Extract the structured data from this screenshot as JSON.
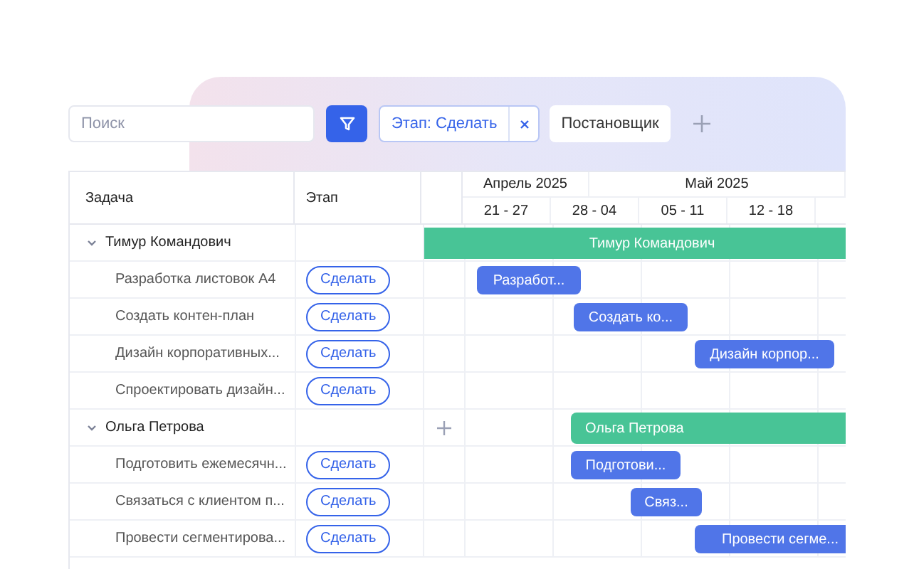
{
  "toolbar": {
    "search": {
      "placeholder": "Поиск"
    },
    "filter_chip": {
      "label": "Этап: Сделать"
    },
    "assignee_button": {
      "label": "Постановщик"
    }
  },
  "table": {
    "columns": [
      "Задача",
      "Этап"
    ],
    "months": [
      "Апрель 2025",
      "Май 2025"
    ],
    "weeks": [
      "21 - 27",
      "28 - 04",
      "05 - 11",
      "12 - 18"
    ],
    "groups": [
      {
        "name": "Тимур Командович",
        "expanded": true,
        "add_button": false,
        "bar_label": "Тимур Командович",
        "tasks": [
          {
            "name": "Разработка листовок А4",
            "stage": "Сделать",
            "bar_label": "Разработ..."
          },
          {
            "name": "Создать контен-план",
            "stage": "Сделать",
            "bar_label": "Создать ко..."
          },
          {
            "name": "Дизайн корпоративных...",
            "stage": "Сделать",
            "bar_label": "Дизайн корпор..."
          },
          {
            "name": "Спроектировать дизайн...",
            "stage": "Сделать"
          }
        ]
      },
      {
        "name": "Ольга Петрова",
        "expanded": true,
        "add_button": true,
        "bar_label": "Ольга Петрова",
        "tasks": [
          {
            "name": "Подготовить ежемесячн...",
            "stage": "Сделать",
            "bar_label": "Подготови..."
          },
          {
            "name": "Связаться с клиентом п...",
            "stage": "Сделать",
            "bar_label": "Связ..."
          },
          {
            "name": "Провести сегментирова...",
            "stage": "Сделать",
            "bar_label": "Провести сегме..."
          }
        ]
      }
    ]
  }
}
